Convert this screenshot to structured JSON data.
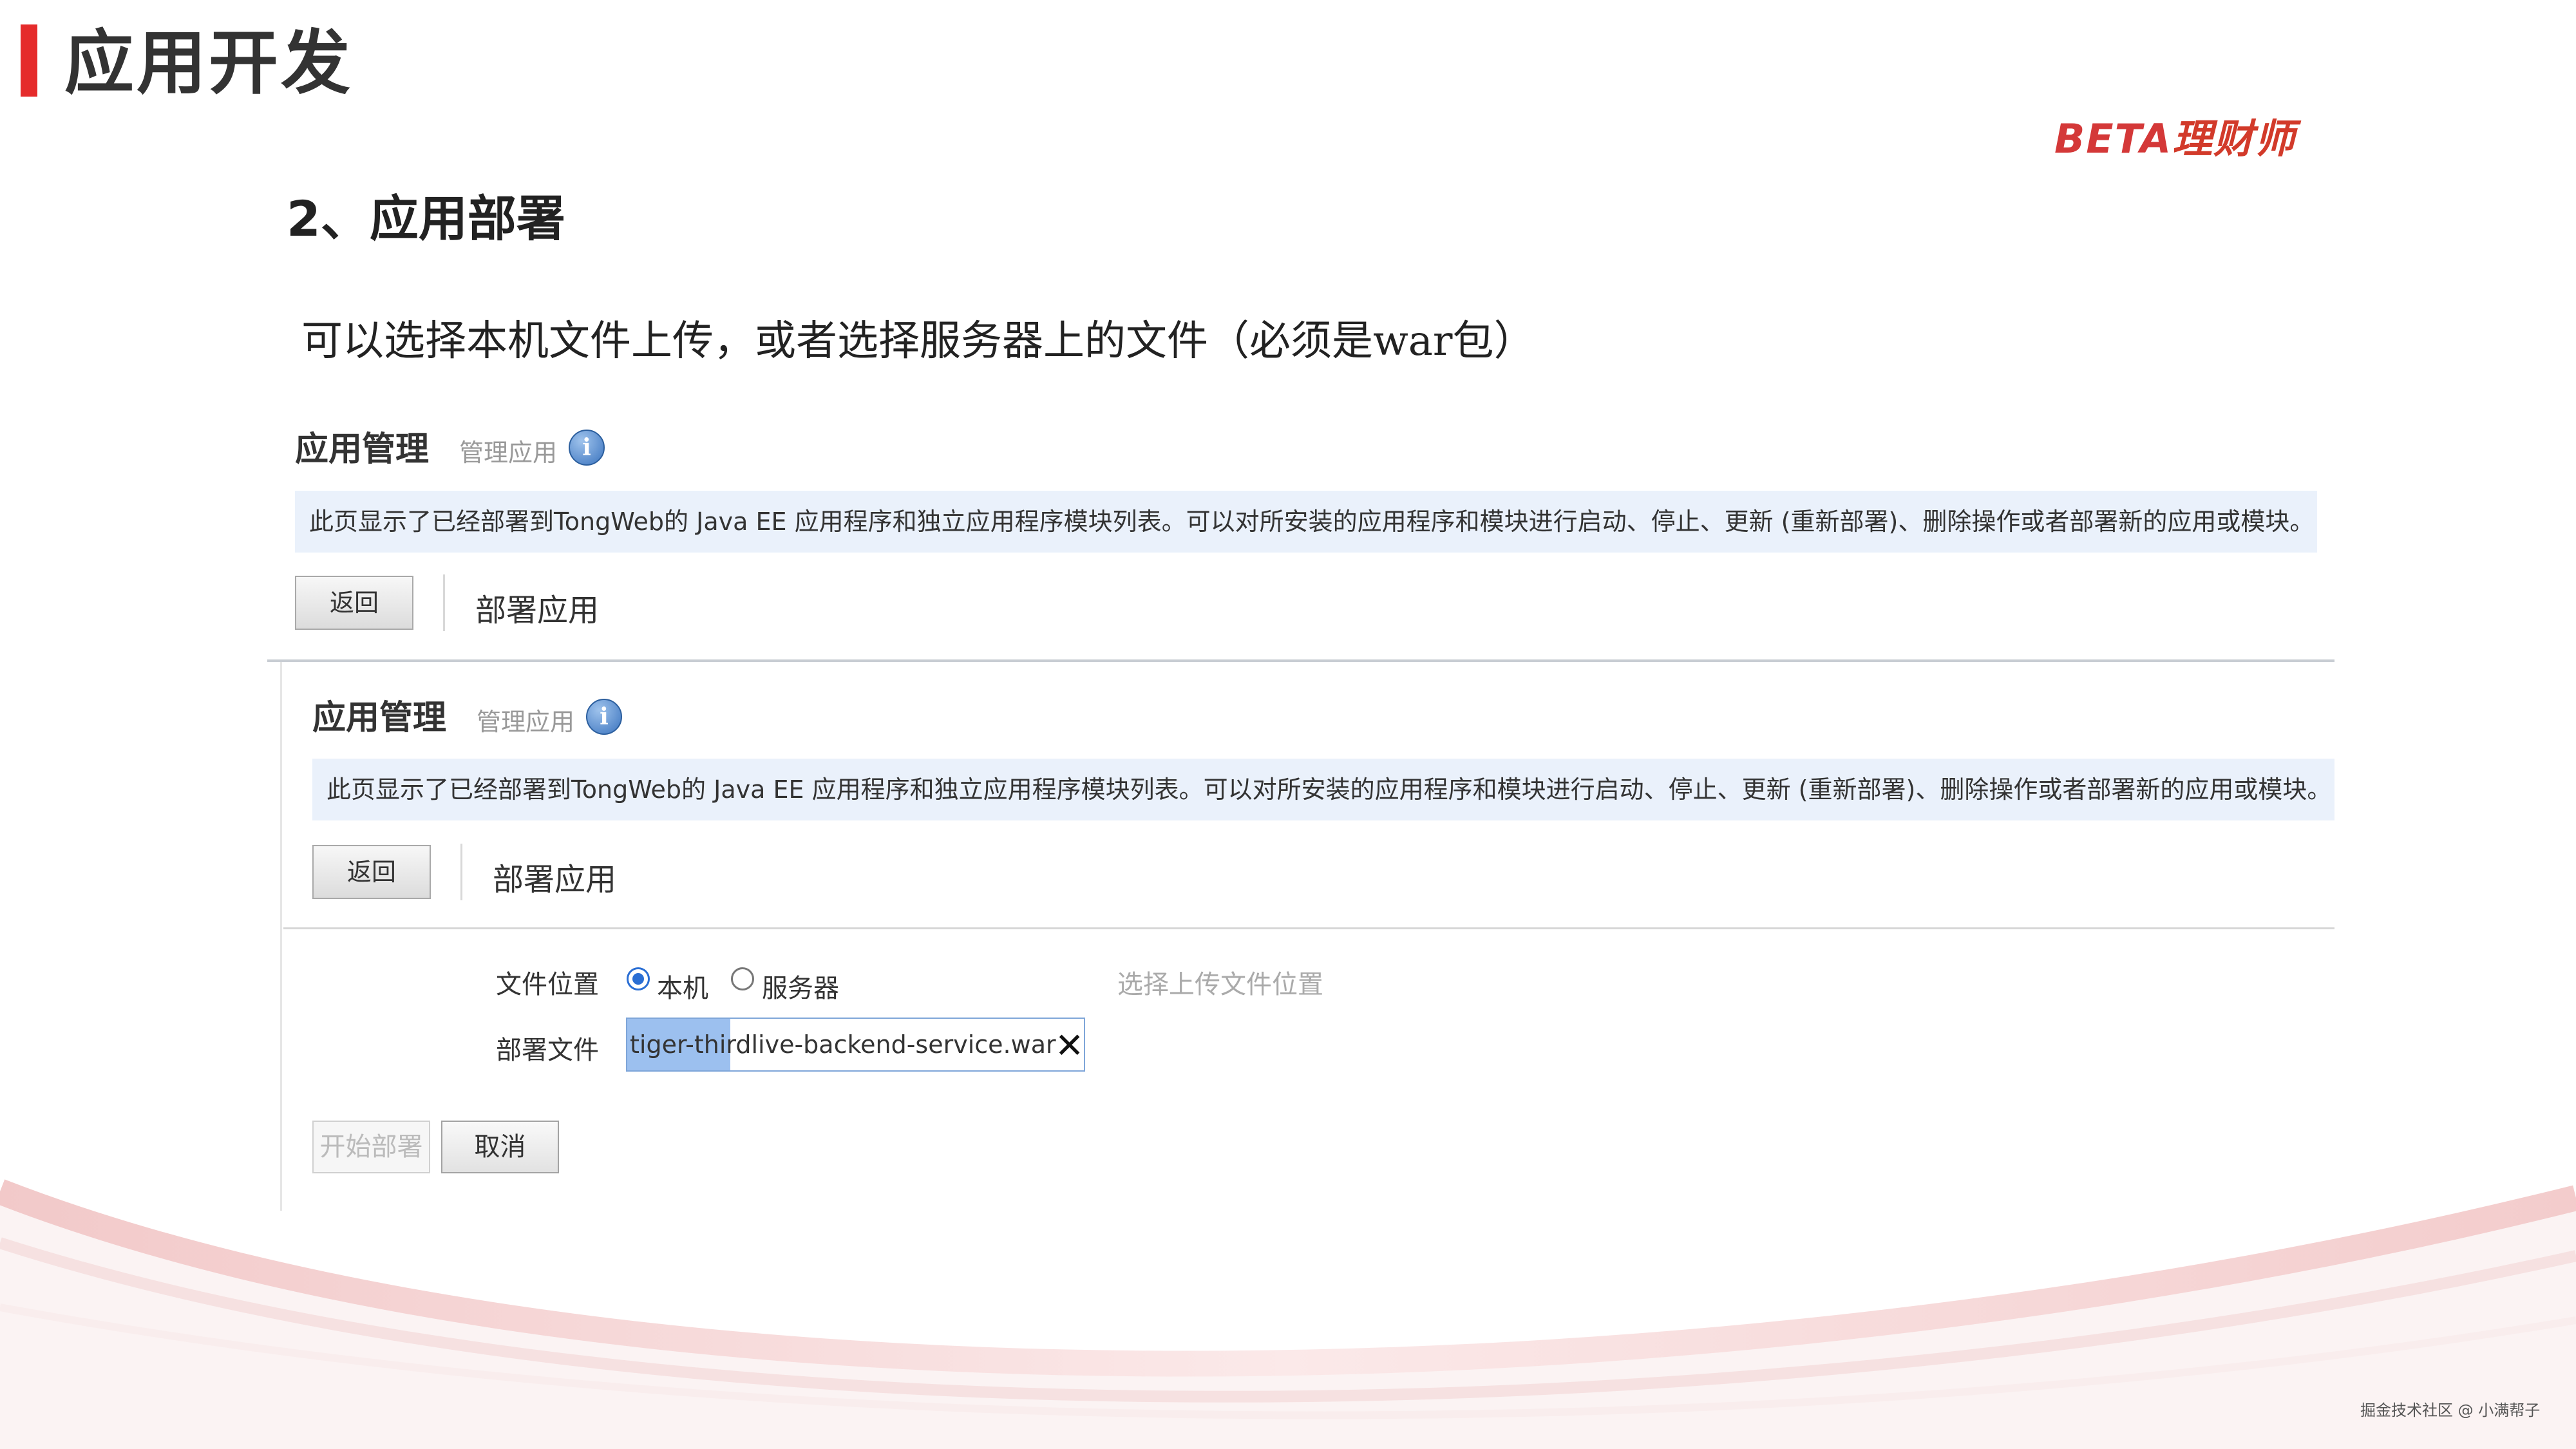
{
  "slide": {
    "title": "应用开发",
    "logo_latin": "BETA",
    "logo_cn": "理财师",
    "section_heading": "2、应用部署",
    "intro": "可以选择本机文件上传，或者选择服务器上的文件（必须是war包）"
  },
  "panel_top": {
    "title": "应用管理",
    "subtitle": "管理应用",
    "info_icon": "info-icon",
    "description": "此页显示了已经部署到TongWeb的 Java EE 应用程序和独立应用程序模块列表。可以对所安装的应用程序和模块进行启动、停止、更新 (重新部署)、删除操作或者部署新的应用或模块。",
    "back_label": "返回",
    "deploy_label": "部署应用"
  },
  "panel_bottom": {
    "title": "应用管理",
    "subtitle": "管理应用",
    "description": "此页显示了已经部署到TongWeb的 Java EE 应用程序和独立应用程序模块列表。可以对所安装的应用程序和模块进行启动、停止、更新 (重新部署)、删除操作或者部署新的应用或模块。",
    "back_label": "返回",
    "deploy_label": "部署应用",
    "form": {
      "file_location_label": "文件位置",
      "option_local": "本机",
      "option_server": "服务器",
      "selected_option": "本机",
      "hint": "选择上传文件位置",
      "deploy_file_label": "部署文件",
      "file_value_selected": "tiger-third",
      "file_value_rest": "live-backend-service.war",
      "clear_glyph": "✕",
      "start_button": "开始部署",
      "cancel_button": "取消"
    }
  },
  "footer": {
    "credit": "掘金技术社区 @ 小满帮子"
  },
  "colors": {
    "accent_red": "#e52b2b",
    "info_blue": "#3b74bf",
    "band_blue": "#eaf1fb"
  }
}
